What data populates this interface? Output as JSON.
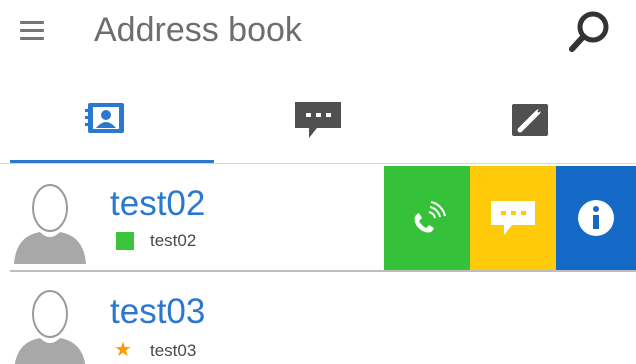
{
  "header": {
    "title": "Address book",
    "menu_icon": "hamburger-menu-icon",
    "search_icon": "search-icon"
  },
  "tabs": [
    {
      "icon": "contacts-icon",
      "active": true
    },
    {
      "icon": "chat-icon",
      "active": false
    },
    {
      "icon": "call-log-icon",
      "active": false
    }
  ],
  "contacts": [
    {
      "name": "test02",
      "status_text": "test02",
      "status": "online",
      "status_color": "#3cc43a",
      "actions": [
        {
          "name": "call-button",
          "icon": "phone-icon",
          "color": "#35c23a"
        },
        {
          "name": "message-button",
          "icon": "chat-icon",
          "color": "#ffca0a"
        },
        {
          "name": "info-button",
          "icon": "info-icon",
          "color": "#1469c7"
        }
      ]
    },
    {
      "name": "test03",
      "status_text": "test03",
      "status": "favorite",
      "status_color": "#ff9a00",
      "status_glyph": "★"
    }
  ],
  "colors": {
    "accent": "#2b78d0",
    "icon_gray": "#505050"
  }
}
